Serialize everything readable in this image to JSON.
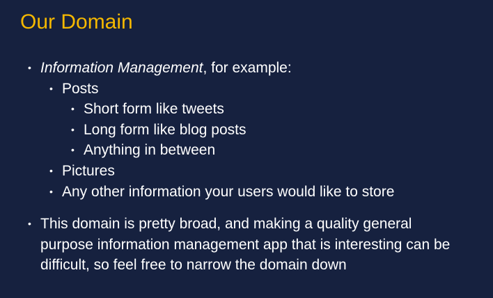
{
  "slide": {
    "title": "Our Domain",
    "accent_color": "#f5b800",
    "background_color": "#16213f",
    "bullets": {
      "b1_em": "Information Management",
      "b1_rest": ", for example:",
      "posts": "Posts",
      "short_form": "Short form like tweets",
      "long_form": "Long form like blog posts",
      "anything": "Anything in between",
      "pictures": "Pictures",
      "other": "Any other information your users would like to store",
      "b2": "This domain is pretty broad, and making a quality general purpose information management app that is interesting can be difficult, so feel free to narrow the domain down"
    }
  }
}
